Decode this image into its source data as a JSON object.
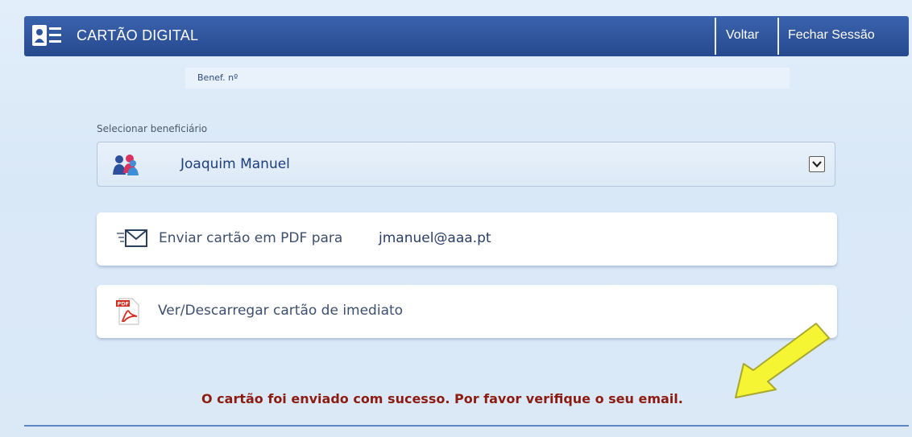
{
  "header": {
    "title": "CARTÃO DIGITAL",
    "back_label": "Voltar",
    "logout_label": "Fechar Sessão",
    "icon": "id-card-icon"
  },
  "beneficiary_number": {
    "label": "Benef. nº",
    "value": ""
  },
  "beneficiary_select": {
    "label": "Selecionar beneficiário",
    "selected": "Joaquim Manuel",
    "icon": "users-icon"
  },
  "actions": {
    "send_pdf": {
      "label": "Enviar cartão em PDF para",
      "email": "jmanuel@aaa.pt",
      "icon": "envelope-icon"
    },
    "download": {
      "label": "Ver/Descarregar cartão de imediato",
      "icon": "pdf-icon"
    }
  },
  "status_message": "O cartão foi enviado com sucesso. Por favor verifique o seu email.",
  "colors": {
    "header_bg": "#2d52a0",
    "message": "#8c1c12",
    "arrow_fill": "#f5f534"
  }
}
